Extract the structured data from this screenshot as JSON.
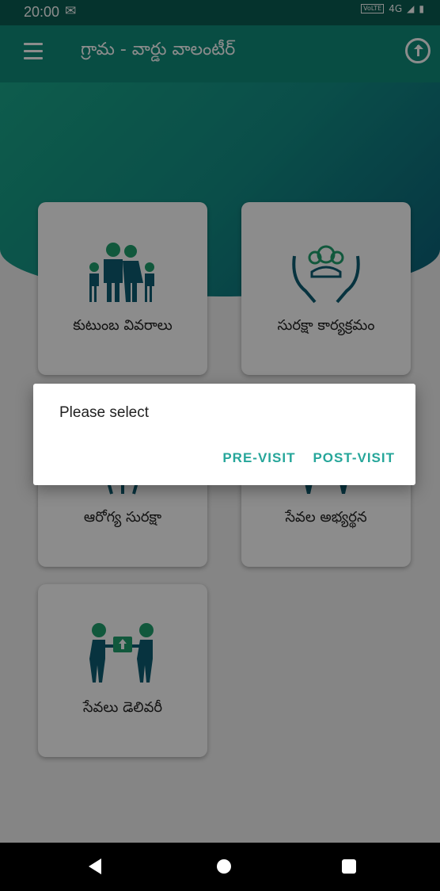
{
  "status_bar": {
    "time": "20:00",
    "network": "4G",
    "volte": "VoLTE"
  },
  "app_bar": {
    "title": "గ్రామ - వార్డు వాలంటీర్"
  },
  "cards": [
    {
      "label": "కుటుంబ వివరాలు",
      "icon": "family-icon"
    },
    {
      "label": "సురక్షా కార్యక్రమం",
      "icon": "care-hands-icon"
    },
    {
      "label": "ఆరోగ్య సురక్షా",
      "icon": "health-icon"
    },
    {
      "label": "సేవల అభ్యర్థన",
      "icon": "service-request-icon"
    },
    {
      "label": "సేవలు డెలివరీ",
      "icon": "delivery-icon"
    }
  ],
  "dialog": {
    "message": "Please select",
    "pre_visit": "PRE-VISIT",
    "post_visit": "POST-VISIT"
  },
  "colors": {
    "primary": "#0f8c7b",
    "accent": "#26a69a",
    "icon_green": "#1fa06e",
    "icon_blue": "#0d5e73"
  }
}
